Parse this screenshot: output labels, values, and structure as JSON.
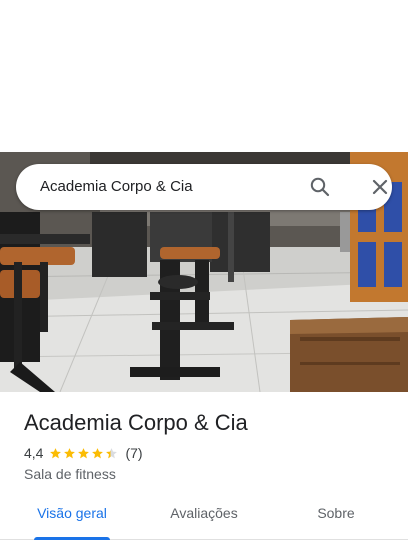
{
  "search": {
    "query": "Academia Corpo & Cia",
    "search_icon": "search-icon",
    "close_icon": "close-icon"
  },
  "photo": {
    "subject": "gym-interior-photo"
  },
  "place": {
    "name": "Academia Corpo & Cia",
    "rating": "4,4",
    "rating_value": 4.4,
    "rating_max": 5,
    "review_count": "(7)",
    "category": "Sala de fitness"
  },
  "tabs": [
    {
      "label": "Visão geral",
      "active": true
    },
    {
      "label": "Avaliações",
      "active": false
    },
    {
      "label": "Sobre",
      "active": false
    }
  ],
  "colors": {
    "accent": "#1a73e8",
    "star": "#fbbc04",
    "star_empty": "#dadce0"
  }
}
